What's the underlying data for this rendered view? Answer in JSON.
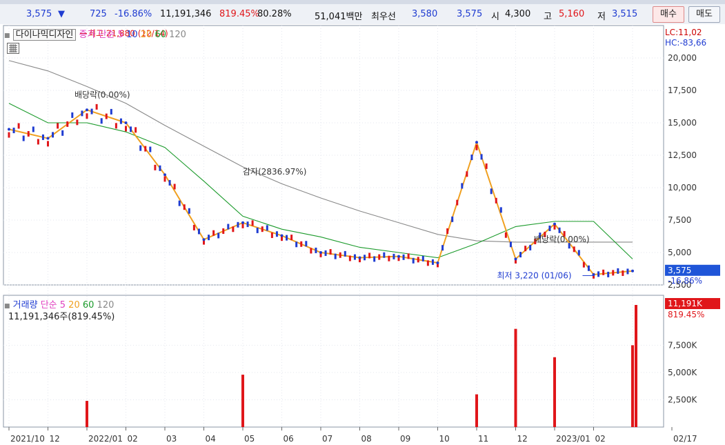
{
  "info_bar": {
    "price": "3,575",
    "down_arrow": "▼",
    "change": "725",
    "change_pct": "-16.86%",
    "volume": "11,191,346",
    "volume_ratio": "819.45%",
    "turnover_pct": "80.28%",
    "amount": "51,041백만",
    "best_label": "최우선",
    "best_ask": "3,580",
    "best_bid": "3,575",
    "open_label": "시",
    "open": "4,300",
    "high_label": "고",
    "high": "5,160",
    "low_label": "저",
    "low": "3,515",
    "buy_button": "매수",
    "sell_button": "매도"
  },
  "price_panel": {
    "stock_name": "다이나믹디자인",
    "ma_label": "종가 단순",
    "ma_periods": [
      "5",
      "10",
      "20",
      "60",
      "120"
    ],
    "ma_colors": [
      "#e040c0",
      "#1f3cd1",
      "#f0a020",
      "#1a9a2a",
      "#888888"
    ],
    "lc_label": "LC:11,02",
    "hc_label": "HC:-83,66",
    "current_price_tag": "3,575",
    "current_pct_tag": "-16.86%",
    "annotations": {
      "high": "최고 21,880 (12/14)",
      "dividend1": "배당락(0.00%)",
      "capital_reduction": "감자(2836.97%)",
      "dividend2": "배당락(0.00%)",
      "low": "최저 3,220 (01/06)"
    }
  },
  "volume_panel": {
    "title": "거래량",
    "ma_label": "단순",
    "ma_periods": [
      "5",
      "20",
      "60",
      "120"
    ],
    "volume_text": "11,191,346주(819.45%)",
    "current_tag": "11,191K",
    "current_pct": "819.45%"
  },
  "chart_data": [
    {
      "type": "line",
      "title": "다이나믹디자인",
      "x": [
        "2021-10",
        "2021-11",
        "2021-12",
        "2022-01",
        "2022-02",
        "2022-03",
        "2022-04",
        "2022-05",
        "2022-06",
        "2022-07",
        "2022-08",
        "2022-09",
        "2022-10",
        "2022-11",
        "2022-12",
        "2023-01",
        "2023-02"
      ],
      "series": [
        {
          "name": "종가",
          "values": [
            14500,
            13800,
            16000,
            15000,
            11000,
            6000,
            7300,
            6300,
            5000,
            4600,
            4700,
            4200,
            13500,
            4500,
            7200,
            3300,
            3575
          ]
        },
        {
          "name": "120",
          "values": [
            19800,
            19000,
            17800,
            16500,
            14800,
            13200,
            11600,
            10300,
            9200,
            8200,
            7300,
            6400,
            5900,
            5800,
            5800,
            5800,
            5800
          ]
        },
        {
          "name": "60",
          "values": [
            16500,
            15000,
            15000,
            14300,
            13100,
            10500,
            7800,
            6800,
            6200,
            5400,
            5000,
            4600,
            5700,
            7000,
            7400,
            7400,
            4500
          ]
        }
      ],
      "ylim": [
        2500,
        22500
      ],
      "y_ticks": [
        "20,000",
        "17,500",
        "15,000",
        "12,500",
        "10,000",
        "7,500",
        "5,000",
        "2,500"
      ],
      "x_tick_labels": [
        "2021/10",
        "12",
        "2022/01",
        "02",
        "03",
        "04",
        "05",
        "06",
        "07",
        "08",
        "09",
        "10",
        "11",
        "12",
        "2023/01",
        "02",
        "02/17"
      ],
      "high": 21880,
      "low": 3220
    },
    {
      "type": "bar",
      "title": "거래량",
      "ylim": [
        0,
        11191
      ],
      "y_ticks": [
        "7,500K",
        "5,000K",
        "2,500K"
      ],
      "notable_volumes_k": [
        {
          "x": "2021-12",
          "value": 2400
        },
        {
          "x": "2022-04",
          "value": 4800
        },
        {
          "x": "2022-10",
          "value": 3000
        },
        {
          "x": "2022-11",
          "value": 9000
        },
        {
          "x": "2022-12",
          "value": 6400
        },
        {
          "x": "2023-02",
          "value": 7500
        },
        {
          "x": "2023-02-17",
          "value": 11191
        }
      ]
    }
  ]
}
